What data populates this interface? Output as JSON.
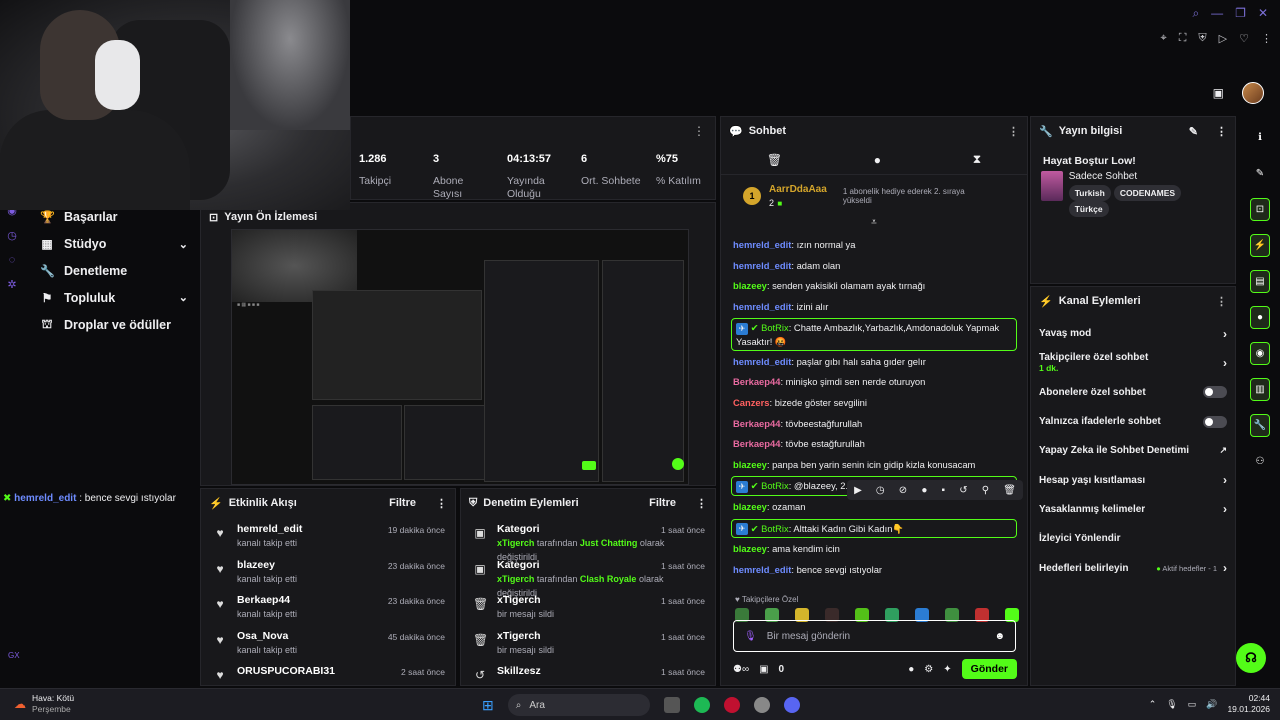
{
  "stats": [
    {
      "value": "1.286",
      "label": "Takipçi"
    },
    {
      "value": "3",
      "label": "Abone Sayısı"
    },
    {
      "value": "04:13:57",
      "label": "Yayında Olduğu"
    },
    {
      "value": "6",
      "label": "Ort. Sohbete"
    },
    {
      "value": "%75",
      "label": "% Katılım"
    }
  ],
  "nav": [
    {
      "label": "Başarılar",
      "icon": "trophy-icon",
      "chev": false
    },
    {
      "label": "Stüdyo",
      "icon": "studio-icon",
      "chev": true
    },
    {
      "label": "Denetleme",
      "icon": "wrench-icon",
      "chev": false
    },
    {
      "label": "Topluluk",
      "icon": "community-icon",
      "chev": true
    },
    {
      "label": "Droplar ve ödüller",
      "icon": "drops-icon",
      "chev": false
    }
  ],
  "overlay_chat": {
    "user": "hemreld_edit",
    "sep": " : ",
    "text": "bence sevgi ıstıyolar"
  },
  "gx": "GX",
  "preview": {
    "title": "Yayın Ön İzlemesi"
  },
  "activity": {
    "title": "Etkinlik Akışı",
    "filter": "Filtre",
    "items": [
      {
        "name": "hemreld_edit",
        "sub": "kanalı takip etti",
        "time": "19 dakika önce"
      },
      {
        "name": "blazeey",
        "sub": "kanalı takip etti",
        "time": "23 dakika önce"
      },
      {
        "name": "Berkaep44",
        "sub": "kanalı takip etti",
        "time": "23 dakika önce"
      },
      {
        "name": "Osa_Nova",
        "sub": "kanalı takip etti",
        "time": "45 dakika önce"
      },
      {
        "name": "ORUSPUCORABI31",
        "sub": "",
        "time": "2 saat önce"
      }
    ]
  },
  "moderation": {
    "title": "Denetim Eylemleri",
    "filter": "Filtre",
    "items": [
      {
        "name": "Kategori",
        "who": "xTigerch",
        "mid": " tarafından ",
        "cat": "Just Chatting",
        "end": " olarak değiştirildi",
        "time": "1 saat önce"
      },
      {
        "name": "Kategori",
        "who": "xTigerch",
        "mid": " tarafından ",
        "cat": "Clash Royale",
        "end": " olarak değiştirildi",
        "time": "1 saat önce"
      },
      {
        "name": "xTigerch",
        "sub": "bir mesajı sildi",
        "time": "1 saat önce"
      },
      {
        "name": "xTigerch",
        "sub": "bir mesajı sildi",
        "time": "1 saat önce"
      },
      {
        "name": "Skillzesz",
        "sub": "",
        "time": "1 saat önce"
      }
    ]
  },
  "chat": {
    "title": "Sohbet",
    "pinned": {
      "user": "AarrDdaAaa",
      "count": "2",
      "note": "1 abonelik hediye ederek 2. sıraya yükseldi",
      "rank": "1"
    },
    "messages": [
      {
        "user": "hemreld_edit",
        "color": "#6e8cff",
        "text": "ızın normal ya"
      },
      {
        "user": "hemreld_edit",
        "color": "#6e8cff",
        "text": "adam olan"
      },
      {
        "user": "blazeey",
        "color": "#53fc18",
        "text": "senden yakisikli olamam ayak tırnağı"
      },
      {
        "user": "hemreld_edit",
        "color": "#6e8cff",
        "text": "izini alır"
      },
      {
        "user": "BotRix",
        "color": "#53fc18",
        "text": "Chatte Ambazlık,Yarbazlık,Amdonadoluk Yapmak Yasaktır! 🤬",
        "bot": true
      },
      {
        "user": "hemreld_edit",
        "color": "#6e8cff",
        "text": "paşlar gıbı halı saha gıder gelır"
      },
      {
        "user": "Berkaep44",
        "color": "#e86aa0",
        "text": "minişko şimdi sen nerde oturuyon"
      },
      {
        "user": "Canzers",
        "color": "#ff6060",
        "text": "bizede göster sevgilini"
      },
      {
        "user": "Berkaep44",
        "color": "#e86aa0",
        "text": "tövbeestağfurullah"
      },
      {
        "user": "Berkaep44",
        "color": "#e86aa0",
        "text": "tövbe estağfurullah"
      },
      {
        "user": "blazeey",
        "color": "#53fc18",
        "text": "panpa ben yarin senin icin gidip kizla konusacam"
      },
      {
        "user": "BotRix",
        "color": "#53fc18",
        "text": "@blazeey, 2.",
        "bot": true
      },
      {
        "user": "blazeey",
        "color": "#53fc18",
        "text": "ozaman"
      },
      {
        "user": "BotRix",
        "color": "#53fc18",
        "text": "Alttaki Kadın Gibi Kadın👇",
        "bot": true
      },
      {
        "user": "blazeey",
        "color": "#53fc18",
        "text": "ama kendim icin"
      },
      {
        "user": "hemreld_edit",
        "color": "#6e8cff",
        "text": "bence sevgi ıstıyolar"
      }
    ],
    "emote_label": "Takipçilere Özel",
    "input_placeholder": "Bir mesaj gönderin",
    "points": "0",
    "send": "Gönder"
  },
  "info": {
    "title": "Yayın bilgisi",
    "stream_title": "Hayat Boştur Low!",
    "category": "Sadece Sohbet",
    "tags": [
      "Turkish",
      "CODENAMES",
      "Türkçe"
    ]
  },
  "actions": {
    "title": "Kanal Eylemleri",
    "items": [
      {
        "label": "Yavaş mod",
        "type": "chev"
      },
      {
        "label": "Takipçilere özel sohbet",
        "sub": "1 dk.",
        "type": "chev"
      },
      {
        "label": "Abonelere özel sohbet",
        "type": "toggle"
      },
      {
        "label": "Yalnızca ifadelerle sohbet",
        "type": "toggle"
      },
      {
        "label": "Yapay Zeka ile Sohbet Denetimi",
        "type": "ext"
      },
      {
        "label": "Hesap yaşı kısıtlaması",
        "type": "chev"
      },
      {
        "label": "Yasaklanmış kelimeler",
        "type": "chev"
      },
      {
        "label": "İzleyici Yönlendir",
        "type": "none"
      },
      {
        "label": "Hedefleri belirleyin",
        "extra": "Aktif hedefler - 1",
        "type": "chev"
      }
    ]
  },
  "taskbar": {
    "weather_title": "Hava: Kötü",
    "weather_day": "Perşembe",
    "search": "Ara",
    "time": "02:44",
    "date": "19.01.2026"
  },
  "colors": {
    "accent": "#53fc18",
    "panel": "#18181b",
    "bg": "#0b0b0d"
  }
}
